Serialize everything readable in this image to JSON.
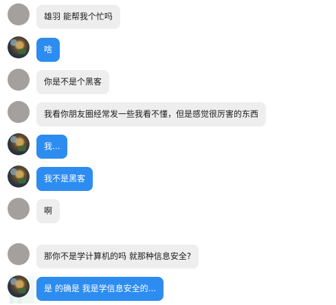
{
  "messages": [
    {
      "side": "in",
      "text": "雄羽 能帮我个忙吗"
    },
    {
      "side": "out",
      "text": "啥"
    },
    {
      "side": "in",
      "text": "你是不是个黑客"
    },
    {
      "side": "in",
      "text": "我看你朋友圈经常发一些我看不懂，但是感觉很厉害的东西"
    },
    {
      "side": "out",
      "text": "我..."
    },
    {
      "side": "out",
      "text": "我不是黑客"
    },
    {
      "side": "in",
      "text": "啊"
    },
    {
      "side": "in",
      "text": "那你不是学计算机的吗 就那种信息安全?"
    },
    {
      "side": "out",
      "text": "是 的确是 我是学信息安全的..."
    }
  ],
  "colors": {
    "incoming_bubble": "#eeeeee",
    "outgoing_bubble": "#2d8cf0",
    "incoming_text": "#1a1a1a",
    "outgoing_text": "#ffffff"
  }
}
